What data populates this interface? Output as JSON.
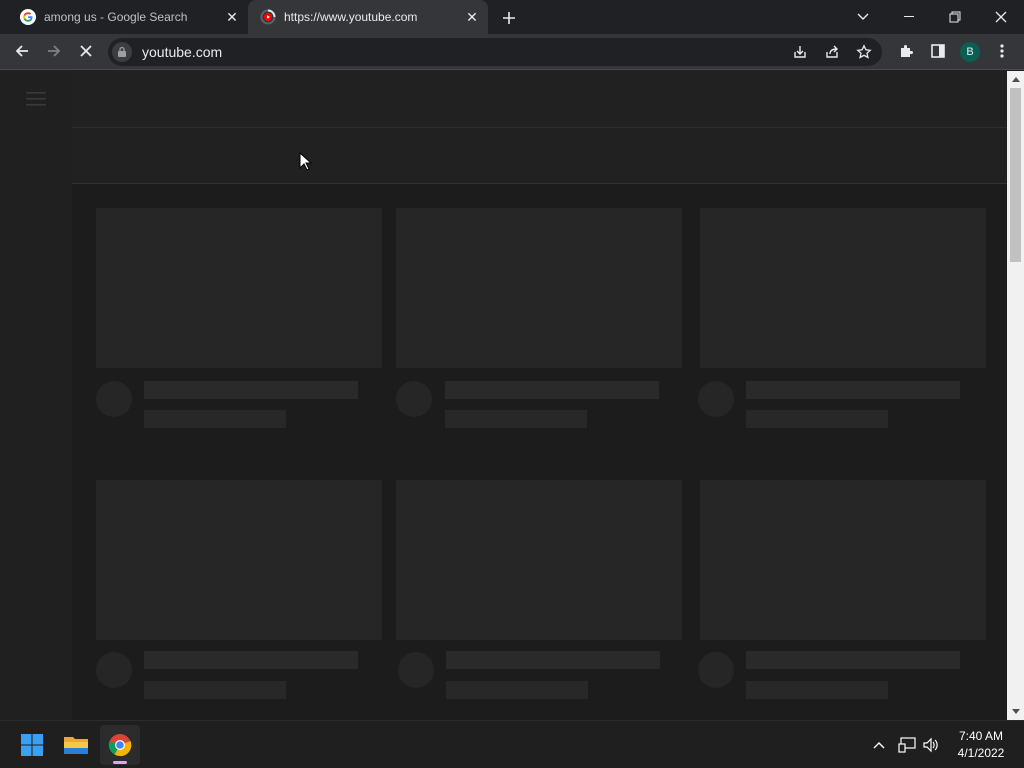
{
  "tabs": [
    {
      "title": "among us - Google Search",
      "favicon": "google-g-icon"
    },
    {
      "title": "https://www.youtube.com",
      "favicon": "youtube-loading-icon",
      "active": true
    }
  ],
  "toolbar": {
    "url": "youtube.com",
    "profile_initial": "B"
  },
  "taskbar": {
    "time": "7:40 AM",
    "date": "4/1/2022"
  },
  "colors": {
    "page_bg": "#212121",
    "skeleton": "#262626",
    "avatar": "#0b5e52"
  }
}
